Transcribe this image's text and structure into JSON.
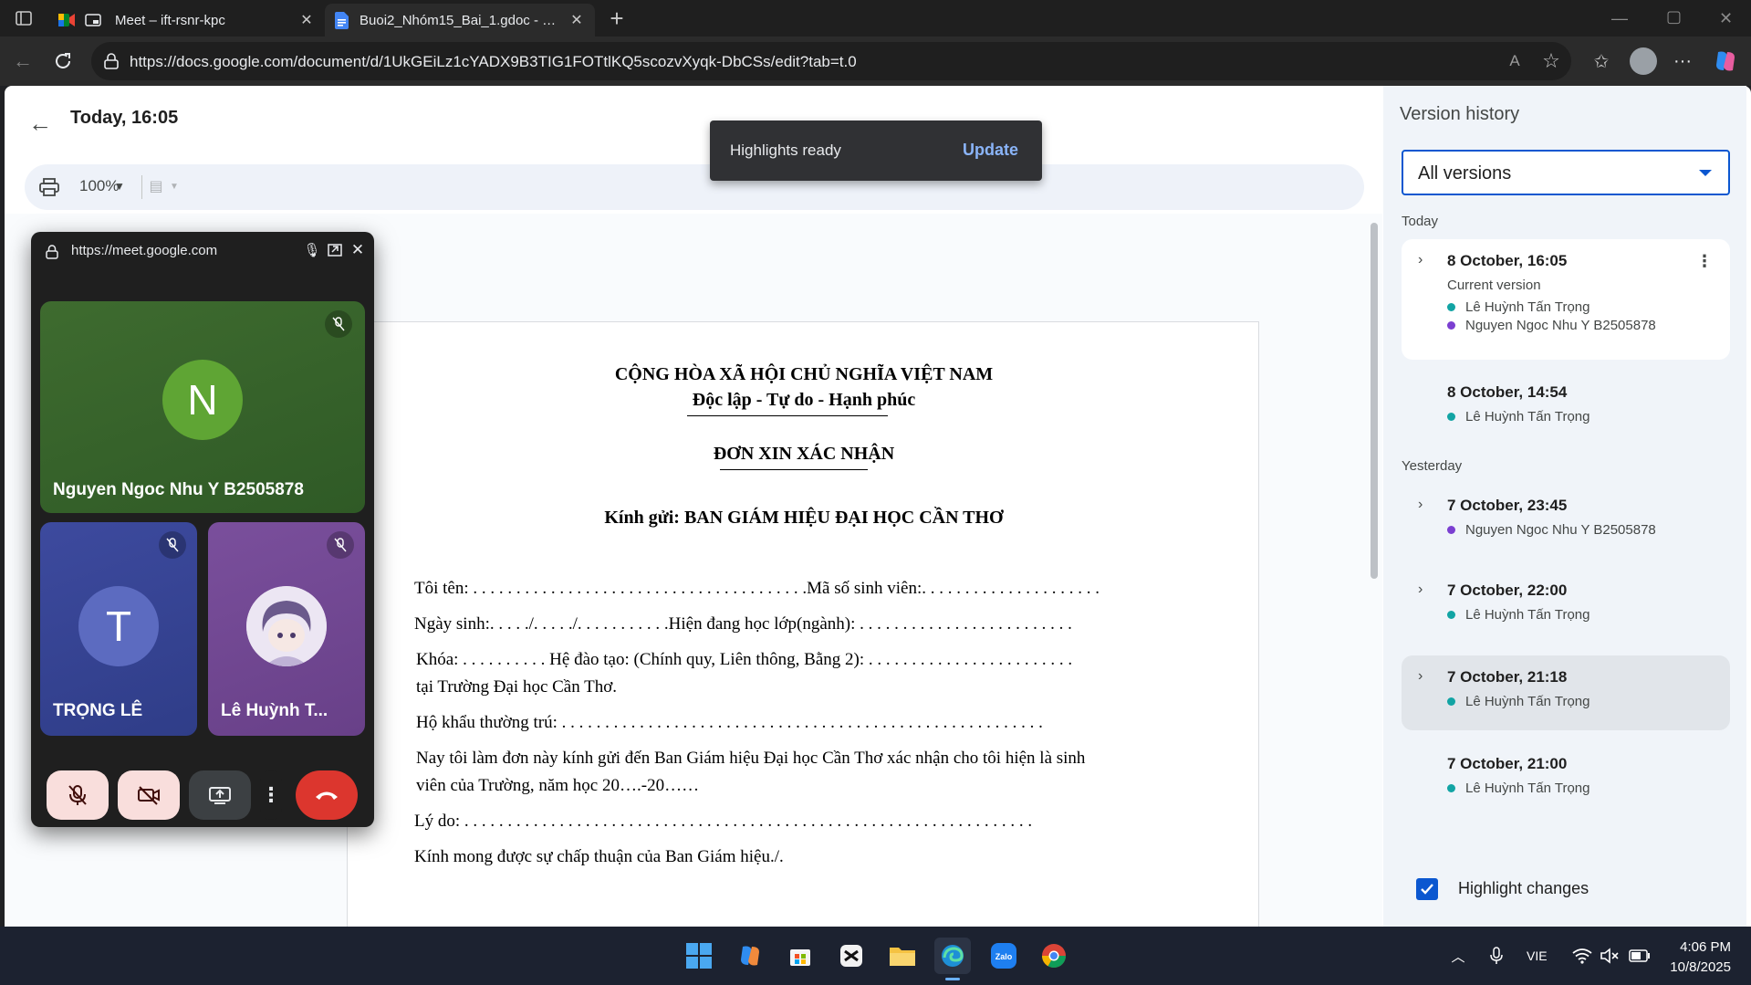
{
  "browser": {
    "tabs": [
      {
        "title": "Meet – ift-rsnr-kpc"
      },
      {
        "title": "Buoi2_Nhóm15_Bai_1.gdoc - Goo"
      }
    ],
    "url": "https://docs.google.com/document/d/1UkGEiLz1cYADX9B3TIG1FOTtlKQ5scozvXyqk-DbCSs/edit?tab=t.0"
  },
  "docs": {
    "version_title": "Today, 16:05",
    "zoom": "100%",
    "snackbar": {
      "text": "Highlights ready",
      "action": "Update"
    },
    "document": {
      "line1": "CỘNG HÒA XÃ HỘI CHỦ NGHĨA VIỆT NAM",
      "line2": "Độc lập - Tự do - Hạnh phúc",
      "title": "ĐƠN XIN XÁC NHẬN",
      "recipient": "Kính gửi: BAN GIÁM HIỆU  ĐẠI HỌC CẦN THƠ",
      "name_line": "Tôi tên: . . . . . . . . . . . . . . . . . . . . . . . . . . . . . . . . . . . . . . .Mã số sinh viên:. . . . . . . . . . . . . . . . . . . . .",
      "dob_line": "Ngày sinh:. . . . ./. . . . ./. . . . . . . . . . .Hiện đang học lớp(ngành): . . . . . . . . . . . . . . . . . . . . . . . . .",
      "course_line": "Khóa:  . . . . . . . . . .  Hệ đào tạo: (Chính quy, Liên thông, Bằng 2):  . . . . . . . . . . . . . . . . . . . . . . . .",
      "course_line2": "tại Trường Đại học Cần Thơ.",
      "address_line": "Hộ khẩu thường trú: . . . . . . . . . . . . . . . . . . . . . . . . . . . . . . . . . . . . . . . . . . . . . . . . . . . . . . . .",
      "body_line1": "Nay tôi làm đơn này kính gửi đến Ban Giám hiệu Đại học Cần Thơ xác nhận cho tôi hiện là sinh",
      "body_line2": "viên của Trường, năm học 20….-20……",
      "reason_line": "Lý do: . . . . . . . . . . . . . . . . . . . . . . . . . . . . . . . . . . . . . . . . . . . . . . . . . . . . . . . . . . . . . . . . . .",
      "closing_line": "Kính mong được sự chấp thuận của Ban Giám hiệu./."
    }
  },
  "version_history": {
    "title": "Version history",
    "filter": "All versions",
    "groups": [
      {
        "label": "Today"
      },
      {
        "label": "Yesterday"
      }
    ],
    "versions": [
      {
        "date": "8 October, 16:05",
        "sub": "Current version",
        "editors": [
          "Lê Huỳnh Tấn Trọng",
          "Nguyen Ngoc Nhu Y B2505878"
        ]
      },
      {
        "date": "8 October, 14:54",
        "editors": [
          "Lê Huỳnh Tấn Trọng"
        ]
      },
      {
        "date": "7 October, 23:45",
        "editors": [
          "Nguyen Ngoc Nhu Y B2505878"
        ]
      },
      {
        "date": "7 October, 22:00",
        "editors": [
          "Lê Huỳnh Tấn Trọng"
        ]
      },
      {
        "date": "7 October, 21:18",
        "editors": [
          "Lê Huỳnh Tấn Trọng"
        ]
      },
      {
        "date": "7 October, 21:00",
        "editors": [
          "Lê Huỳnh Tấn Trọng"
        ]
      }
    ],
    "highlight_label": "Highlight changes",
    "highlight_checked": true,
    "colors": {
      "teal": "#12a4a4",
      "purple": "#7b3fd1",
      "accent": "#0b57d0"
    }
  },
  "meet_pip": {
    "url": "https://meet.google.com",
    "participants": [
      {
        "initial": "N",
        "name": "Nguyen Ngoc Nhu Y B2505878",
        "muted": true
      },
      {
        "initial": "T",
        "name": "TRỌNG LÊ",
        "muted": true
      },
      {
        "initial": "",
        "name": "Lê Huỳnh T...",
        "muted": true
      }
    ],
    "controls": [
      "mic-off",
      "camera-off",
      "present",
      "more",
      "leave-call"
    ]
  },
  "taskbar": {
    "language": "VIE",
    "time": "4:06 PM",
    "date": "10/8/2025"
  }
}
